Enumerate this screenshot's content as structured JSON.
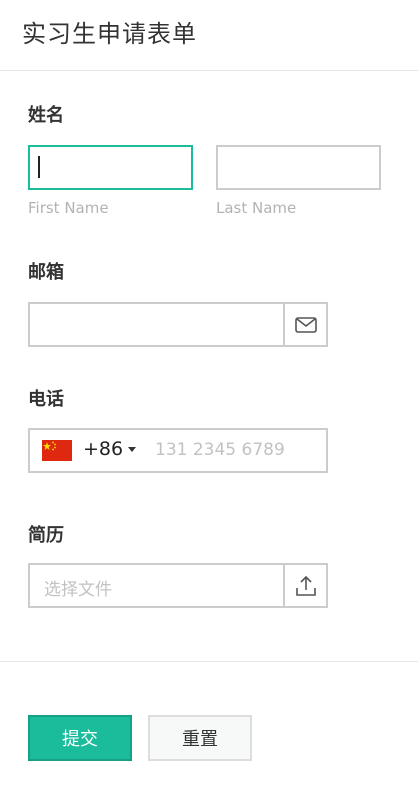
{
  "header": {
    "title": "实习生申请表单"
  },
  "name": {
    "label": "姓名",
    "first_hint": "First Name",
    "last_hint": "Last Name",
    "first_value": "",
    "last_value": ""
  },
  "email": {
    "label": "邮箱",
    "value": "",
    "icon": "envelope-icon"
  },
  "phone": {
    "label": "电话",
    "country_flag": "china-flag-icon",
    "dial_code": "+86",
    "placeholder": "131 2345 6789",
    "value": ""
  },
  "resume": {
    "label": "简历",
    "placeholder": "选择文件",
    "icon": "upload-icon"
  },
  "actions": {
    "submit_label": "提交",
    "reset_label": "重置"
  },
  "colors": {
    "accent": "#1abc9c",
    "border": "#cccccc"
  }
}
